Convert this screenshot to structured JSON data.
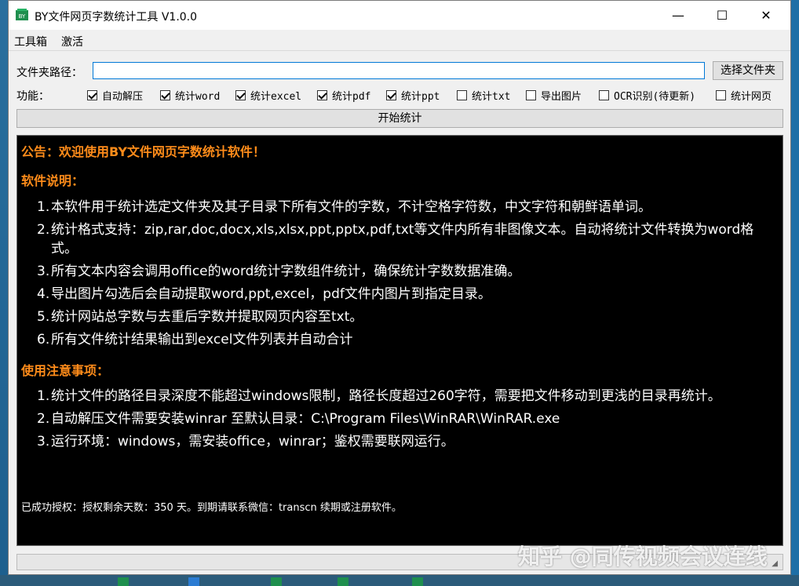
{
  "window": {
    "title": "BY文件网页字数统计工具 V1.0.0",
    "minimize_glyph": "—",
    "maximize_glyph": "☐",
    "close_glyph": "✕"
  },
  "menu": {
    "toolbox": "工具箱",
    "activate": "激活"
  },
  "path_row": {
    "label": "文件夹路径：",
    "value": "",
    "choose_button": "选择文件夹"
  },
  "functions": {
    "label": "功能：",
    "options": [
      {
        "label": "自动解压",
        "checked": true
      },
      {
        "label": "统计word",
        "checked": true
      },
      {
        "label": "统计excel",
        "checked": true
      },
      {
        "label": "统计pdf",
        "checked": true
      },
      {
        "label": "统计ppt",
        "checked": true
      },
      {
        "label": "统计txt",
        "checked": false
      },
      {
        "label": "导出图片",
        "checked": false
      },
      {
        "label": "OCR识别(待更新)",
        "checked": false
      },
      {
        "label": "统计网页",
        "checked": false
      }
    ]
  },
  "start_button": "开始统计",
  "console": {
    "notice": "公告：欢迎使用BY文件网页字数统计软件！",
    "section1_title": "软件说明：",
    "section1_items": [
      {
        "num": "1.",
        "text": "本软件用于统计选定文件夹及其子目录下所有文件的字数，不计空格字符数，中文字符和朝鲜语单词。"
      },
      {
        "num": "2.",
        "text": "统计格式支持：zip,rar,doc,docx,xls,xlsx,ppt,pptx,pdf,txt等文件内所有非图像文本。自动将统计文件转换为word格",
        "text2": "式。"
      },
      {
        "num": "3.",
        "text": "所有文本内容会调用office的word统计字数组件统计，确保统计字数数据准确。"
      },
      {
        "num": "4.",
        "text": "导出图片勾选后会自动提取word,ppt,excel，pdf文件内图片到指定目录。"
      },
      {
        "num": "5.",
        "text": "统计网站总字数与去重后字数并提取网页内容至txt。"
      },
      {
        "num": "6.",
        "text": "所有文件统计结果输出到excel文件列表并自动合计"
      }
    ],
    "section2_title": "使用注意事项：",
    "section2_items": [
      {
        "num": "1.",
        "text": "统计文件的路径目录深度不能超过windows限制，路径长度超过260字符，需要把文件移动到更浅的目录再统计。"
      },
      {
        "num": "2.",
        "text": "自动解压文件需要安装winrar 至默认目录：C:\\Program Files\\WinRAR\\WinRAR.exe"
      },
      {
        "num": "3.",
        "text": "运行环境：windows，需安装office，winrar；鉴权需要联网运行。"
      }
    ],
    "license_note": "已成功授权：授权剩余天数：350 天。到期请联系微信：transcn 续期或注册软件。"
  },
  "watermark": "知乎 @同传视频会议连线",
  "colors": {
    "notice_orange": "#ff8c1a",
    "console_bg": "#000000",
    "input_border": "#0078d7"
  }
}
